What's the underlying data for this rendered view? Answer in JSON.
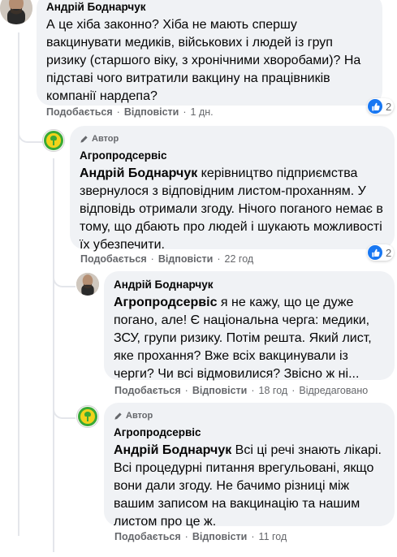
{
  "comments": [
    {
      "author": "Андрій Боднарчук",
      "text": "А це хіба законно? Хіба не мають спершу вакцинувати медиків, військових і людей із груп ризику (старшого віку, з хронічними хворобами)? На підставі чого витратили вакцину на працівників компанії нардепа?",
      "like_label": "Подобається",
      "reply_label": "Відповісти",
      "time": "1 дн.",
      "reactions": "2",
      "avatar_icon": "user-photo-icon"
    }
  ],
  "replies": [
    {
      "badge": "Автор",
      "author": "Агропродсервіс",
      "mention": "Андрій Боднарчук",
      "text": " керівництво підприємства звернулося з відповідним листом-проханням. У відповідь отримали згоду. Нічого поганого немає в тому, що дбають про людей і шукають можливості їх убезпечити.",
      "like_label": "Подобається",
      "reply_label": "Відповісти",
      "time": "22 год",
      "reactions": "2",
      "avatar_icon": "company-logo-icon"
    },
    {
      "author": "Андрій Боднарчук",
      "mention": "Агропродсервіс",
      "text": " я не кажу, що це дуже погано, але! Є національна черга: медики, ЗСУ, групи ризику. Потім решта. Який лист, яке прохання? Вже всіх вакцинували із черги? Чи всі відмовилися? Звісно ж ні...",
      "like_label": "Подобається",
      "reply_label": "Відповісти",
      "time": "18 год",
      "edited": "Відредаговано",
      "avatar_icon": "user-photo-icon"
    },
    {
      "badge": "Автор",
      "author": "Агропродсервіс",
      "mention": "Андрій Боднарчук",
      "text": " Всі ці речі знають лікарі. Всі процедурні питання врегульовані, якщо вони дали згоду. Не бачимо різниці між вашим записом на вакцинацію та нашим листом про це ж.",
      "like_label": "Подобається",
      "reply_label": "Відповісти",
      "time": "11 год",
      "avatar_icon": "company-logo-icon"
    }
  ],
  "colors": {
    "bubble": "#f0f2f5",
    "meta": "#65676b",
    "like": "#1877f2",
    "logo_green": "#3aa935",
    "logo_yellow": "#f2d21b"
  }
}
